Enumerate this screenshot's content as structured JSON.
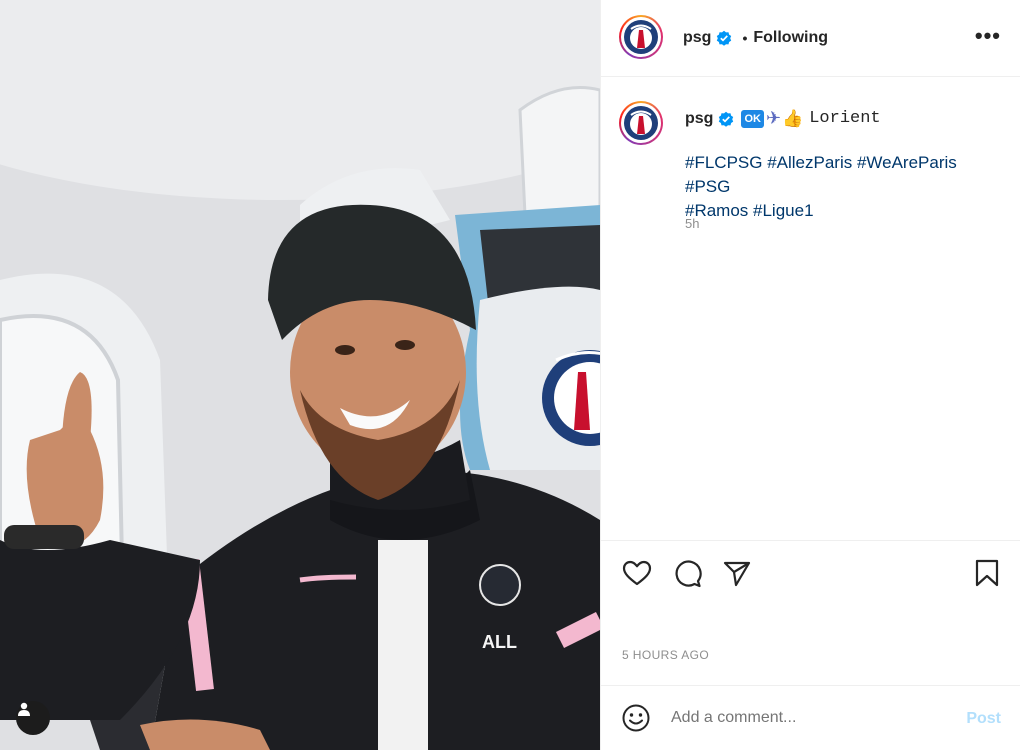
{
  "post": {
    "header": {
      "username": "psg",
      "separator": "•",
      "follow_status": "Following",
      "more": "•••"
    },
    "caption": {
      "username": "psg",
      "emoji_ok": "OK",
      "emoji_plane": "✈",
      "emoji_thumb": "👍",
      "location": "Lorient",
      "hashtags_line1": "#FLCPSG #AllezParis #WeAreParis #PSG",
      "hashtags_line2": "#Ramos #Ligue1",
      "time": "5h"
    },
    "timestamp": "5 HOURS AGO",
    "comment": {
      "placeholder": "Add a comment...",
      "post_label": "Post"
    },
    "icons": [
      "user-tag-icon",
      "verified-icon",
      "more-icon",
      "heart-icon",
      "comment-icon",
      "share-icon",
      "bookmark-icon",
      "emoji-icon"
    ],
    "colors": {
      "link": "#00376b",
      "muted": "#8e8e8e",
      "post_disabled": "#b2dffc",
      "verified": "#0095f6"
    }
  }
}
